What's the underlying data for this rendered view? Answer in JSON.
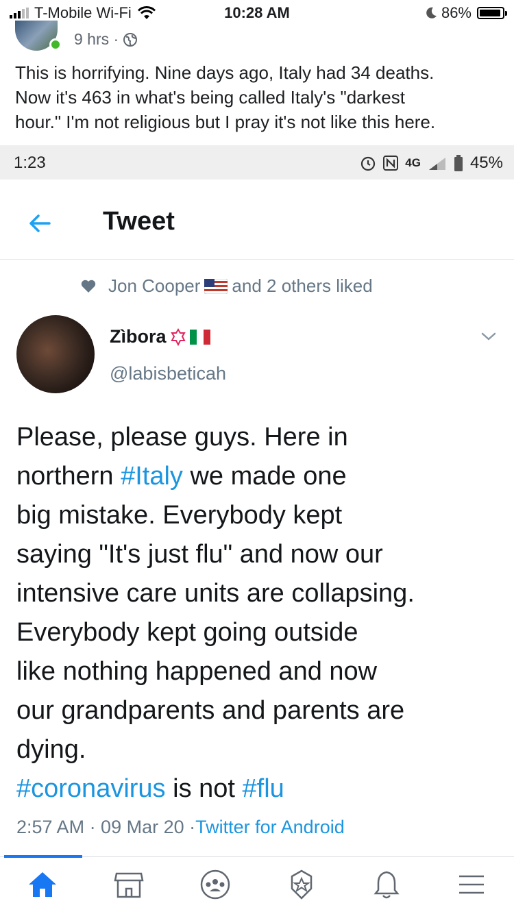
{
  "status_bar": {
    "carrier": "T-Mobile Wi-Fi",
    "time": "10:28 AM",
    "battery": "86%",
    "battery_level": 0.86
  },
  "post": {
    "age": "9 hrs ·",
    "text": "This is horrifying. Nine days ago, Italy had 34 deaths.\nNow it's 463 in what's being called Italy's \"darkest\nhour.\" I'm not religious but I pray it's not like this here.",
    "icons": [
      "avatar",
      "online-dot",
      "globe-icon"
    ]
  },
  "screenshot": {
    "android_status": {
      "time": "1:23",
      "network": "4G",
      "battery": "45%"
    },
    "header": {
      "title": "Tweet"
    },
    "liked_by": {
      "name": "Jon Cooper",
      "rest": "and 2 others liked"
    },
    "author": {
      "name": "Zìbora",
      "handle": "@labisbeticah"
    },
    "tweet": {
      "lines": [
        "Please, please guys. Here in",
        [
          "northern ",
          "#Italy",
          " we made one"
        ],
        "big mistake. Everybody kept",
        "saying \"It's just flu\" and now our",
        "intensive care units are collapsing.",
        "Everybody kept going outside",
        "like nothing happened and now",
        "our grandparents and parents are",
        "dying.",
        [
          "#coronavirus",
          " is not ",
          "#flu"
        ]
      ],
      "timestamp": "2:57 AM · 09 Mar 20 · ",
      "source": "Twitter for Android"
    },
    "colors": {
      "link": "#1b95e0",
      "muted": "#657786"
    }
  },
  "bottom_nav": {
    "items": [
      "home-icon",
      "marketplace-icon",
      "groups-icon",
      "watch-icon",
      "notifications-icon",
      "menu-icon"
    ],
    "active": "home-icon",
    "active_color": "#1877f2"
  }
}
